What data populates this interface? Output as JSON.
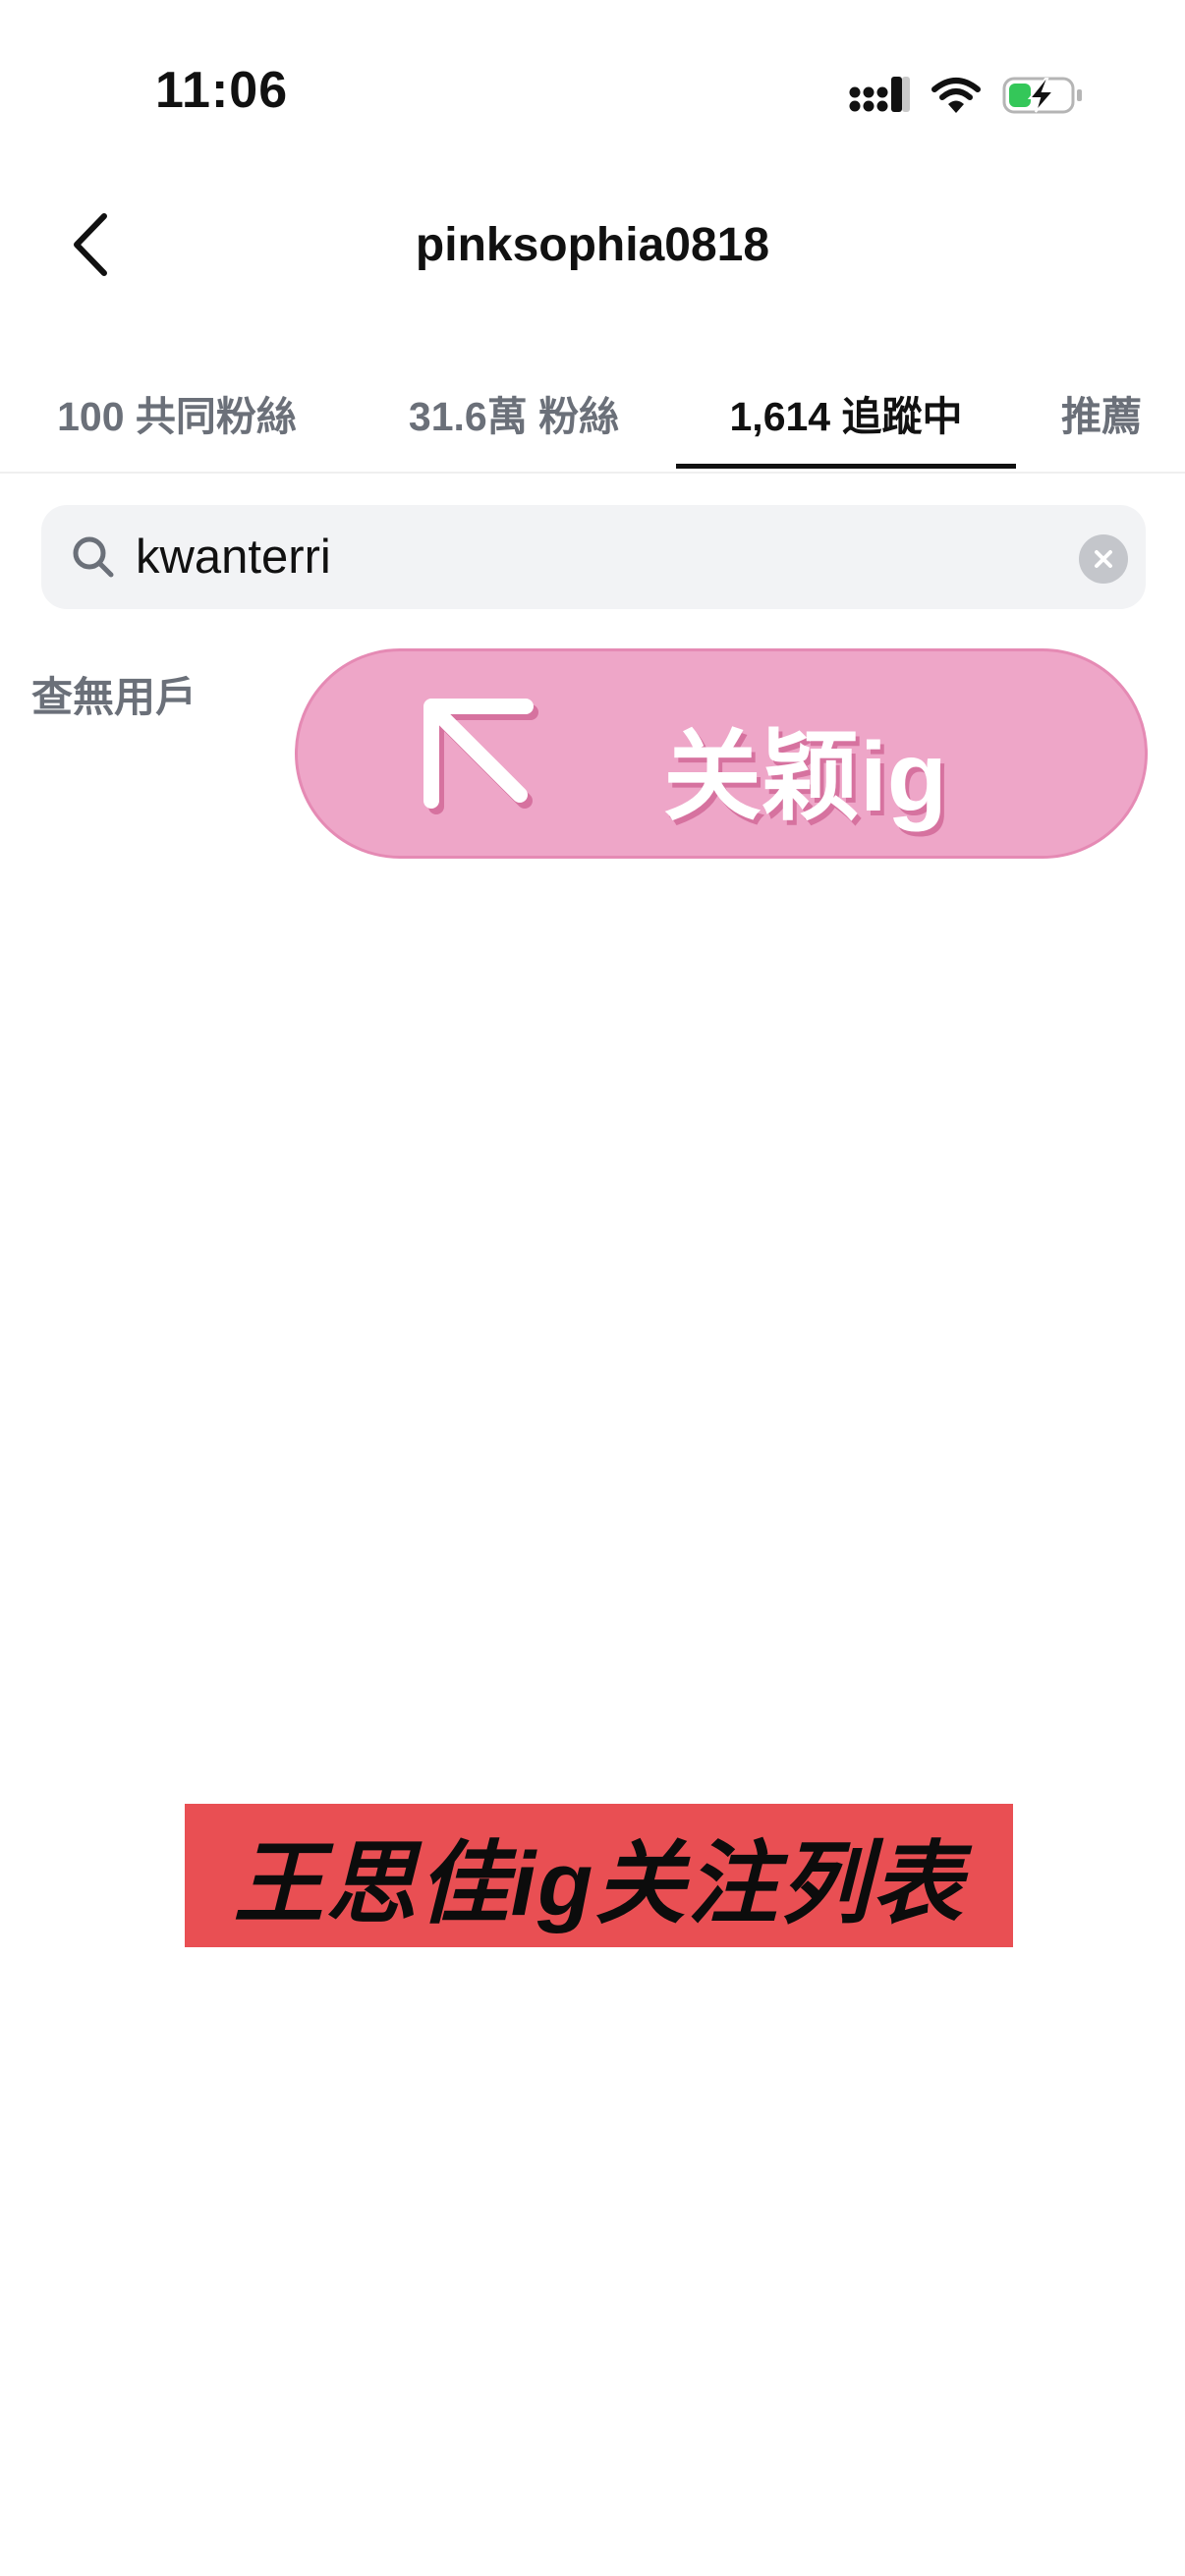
{
  "status_bar": {
    "time": "11:06"
  },
  "header": {
    "title": "pinksophia0818"
  },
  "tabs": [
    {
      "label": "100 共同粉絲",
      "active": false
    },
    {
      "label": "31.6萬 粉絲",
      "active": false
    },
    {
      "label": "1,614 追蹤中",
      "active": true
    },
    {
      "label": "推薦",
      "active": false
    }
  ],
  "search": {
    "value": "kwanterri"
  },
  "results": {
    "empty_text": "查無用戶"
  },
  "overlay": {
    "promo_text": "关颖ig",
    "caption_text": "王思佳ig关注列表"
  },
  "colors": {
    "promo_pink": "#eea6c8",
    "caption_red": "#e94f53",
    "battery_green": "#34c759"
  }
}
